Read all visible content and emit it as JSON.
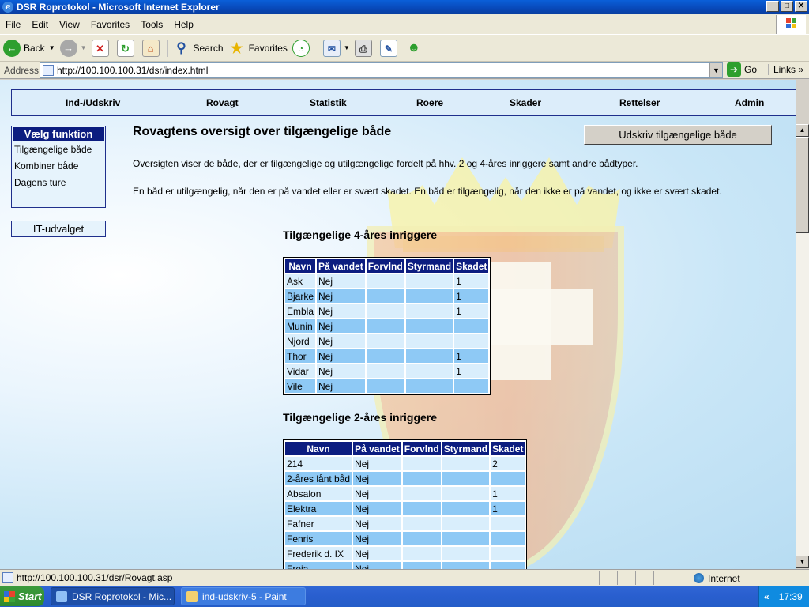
{
  "window": {
    "title": "DSR Roprotokol - Microsoft Internet Explorer",
    "controls": {
      "minimize": "_",
      "maximize": "□",
      "close": "✕"
    }
  },
  "menu": [
    "File",
    "Edit",
    "View",
    "Favorites",
    "Tools",
    "Help"
  ],
  "toolbar": {
    "back": "Back",
    "search": "Search",
    "favorites": "Favorites"
  },
  "address": {
    "label": "Address",
    "url": "http://100.100.100.31/dsr/index.html",
    "go": "Go",
    "links": "Links"
  },
  "nav": [
    "Ind-/Udskriv",
    "Rovagt",
    "Statistik",
    "Roere",
    "Skader",
    "Rettelser",
    "Admin"
  ],
  "sidebar": {
    "header": "Vælg funktion",
    "items": [
      "Tilgængelige både",
      "Kombiner både",
      "Dagens ture"
    ],
    "it_button": "IT-udvalget"
  },
  "main": {
    "title": "Rovagtens oversigt over tilgængelige både",
    "print_button": "Udskriv tilgængelige både",
    "para1": "Oversigten viser de både, der er tilgængelige og utilgængelige fordelt på hhv. 2 og 4-åres inriggere samt andre bådtyper.",
    "para2": "En båd er utilgængelig, når den er på vandet eller er svært skadet. En båd er tilgængelig, når den ikke er på vandet, og ikke er svært skadet.",
    "table_headers": [
      "Navn",
      "På vandet",
      "Forvlnd",
      "Styrmand",
      "Skadet"
    ],
    "section4": {
      "title": "Tilgængelige 4-åres inriggere",
      "rows": [
        [
          "Ask",
          "Nej",
          "",
          "",
          "1"
        ],
        [
          "Bjarke",
          "Nej",
          "",
          "",
          "1"
        ],
        [
          "Embla",
          "Nej",
          "",
          "",
          "1"
        ],
        [
          "Munin",
          "Nej",
          "",
          "",
          ""
        ],
        [
          "Njord",
          "Nej",
          "",
          "",
          ""
        ],
        [
          "Thor",
          "Nej",
          "",
          "",
          "1"
        ],
        [
          "Vidar",
          "Nej",
          "",
          "",
          "1"
        ],
        [
          "Vile",
          "Nej",
          "",
          "",
          ""
        ]
      ]
    },
    "section2": {
      "title": "Tilgængelige 2-åres inriggere",
      "rows": [
        [
          "214",
          "Nej",
          "",
          "",
          "2"
        ],
        [
          "2-åres lånt båd",
          "Nej",
          "",
          "",
          ""
        ],
        [
          "Absalon",
          "Nej",
          "",
          "",
          "1"
        ],
        [
          "Elektra",
          "Nej",
          "",
          "",
          "1"
        ],
        [
          "Fafner",
          "Nej",
          "",
          "",
          ""
        ],
        [
          "Fenris",
          "Nej",
          "",
          "",
          ""
        ],
        [
          "Frederik d. IX",
          "Nej",
          "",
          "",
          ""
        ],
        [
          "Freja",
          "Nej",
          "",
          "",
          ""
        ]
      ]
    }
  },
  "status": {
    "url": "http://100.100.100.31/dsr/Rovagt.asp",
    "zone": "Internet"
  },
  "taskbar": {
    "start": "Start",
    "tasks": [
      "DSR Roprotokol - Mic...",
      "ind-udskriv-5 - Paint"
    ],
    "chevron": "«",
    "time": "17:39"
  }
}
